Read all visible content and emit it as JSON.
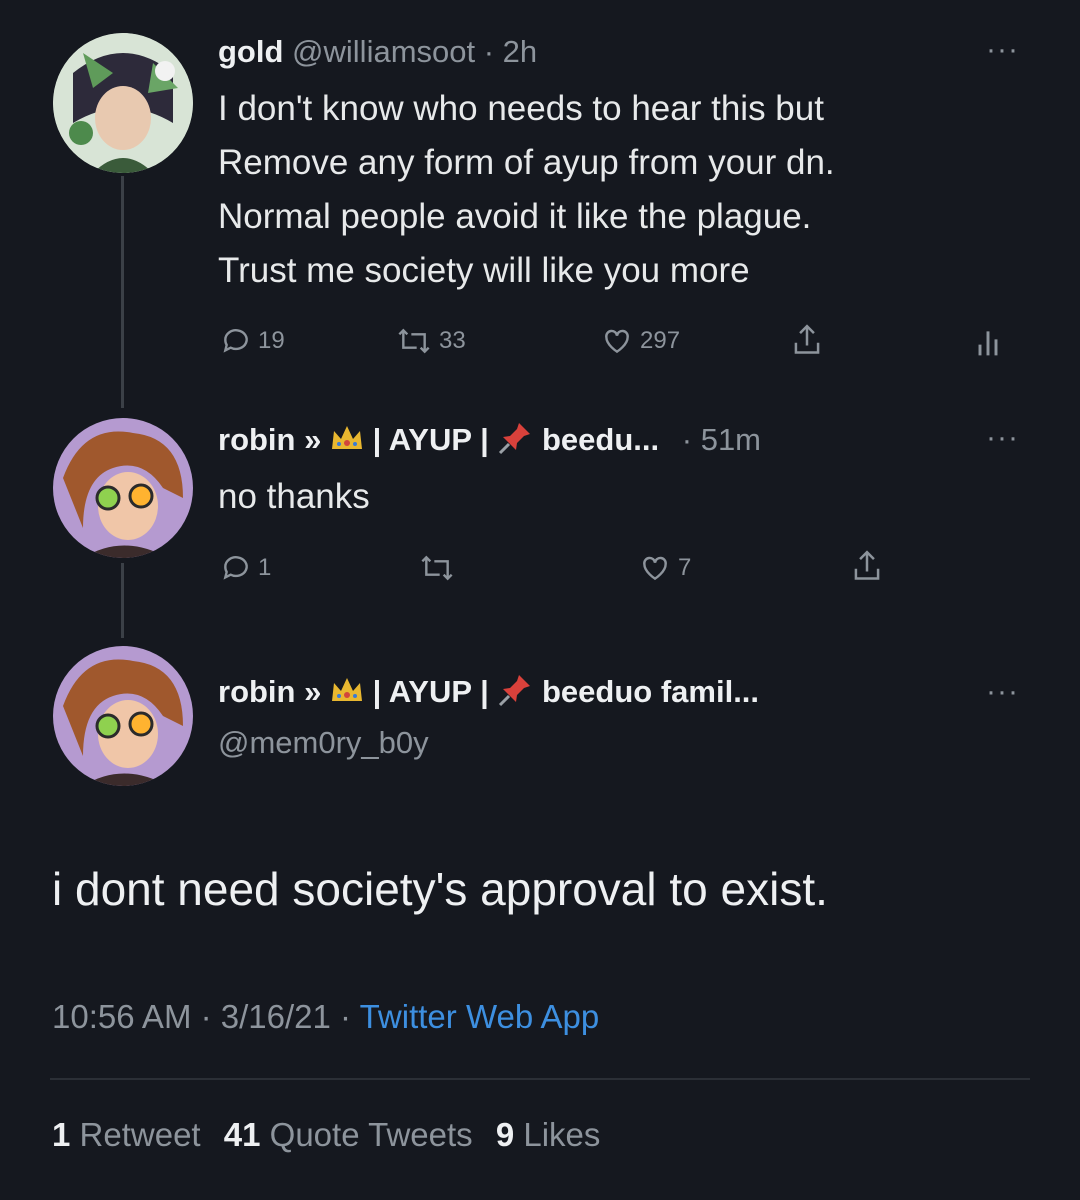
{
  "tweet1": {
    "display_name": "gold",
    "handle": "@williamsoot",
    "time": "· 2h",
    "lines": [
      "I don't know who needs to hear this but",
      "Remove any form of ayup from your dn.",
      "Normal people avoid it like the plague.",
      "Trust me society will like you more"
    ],
    "replies": "19",
    "retweets": "33",
    "likes": "297"
  },
  "tweet2": {
    "name_prefix": "robin »",
    "name_middle": "| AYUP |",
    "name_suffix": "beedu...",
    "time": "· 51m",
    "text": "no thanks",
    "replies": "1",
    "likes": "7"
  },
  "main": {
    "name_prefix": "robin »",
    "name_middle": "| AYUP |",
    "name_suffix": "beeduo famil...",
    "handle": "@mem0ry_b0y",
    "text": "i dont need society's approval to exist.",
    "timestamp": "10:56 AM · 3/16/21 ·",
    "source": "Twitter Web App"
  },
  "stats": {
    "retweets_num": "1",
    "retweets_label": "Retweet",
    "quotes_num": "41",
    "quotes_label": "Quote Tweets",
    "likes_num": "9",
    "likes_label": "Likes"
  },
  "icons": [
    "more-icon",
    "reply-icon",
    "retweet-icon",
    "like-icon",
    "share-icon",
    "analytics-icon",
    "crown-icon",
    "pushpin-icon"
  ],
  "colors": {
    "background": "#15181f",
    "link": "#3d8fe0",
    "muted": "#8d949c"
  }
}
